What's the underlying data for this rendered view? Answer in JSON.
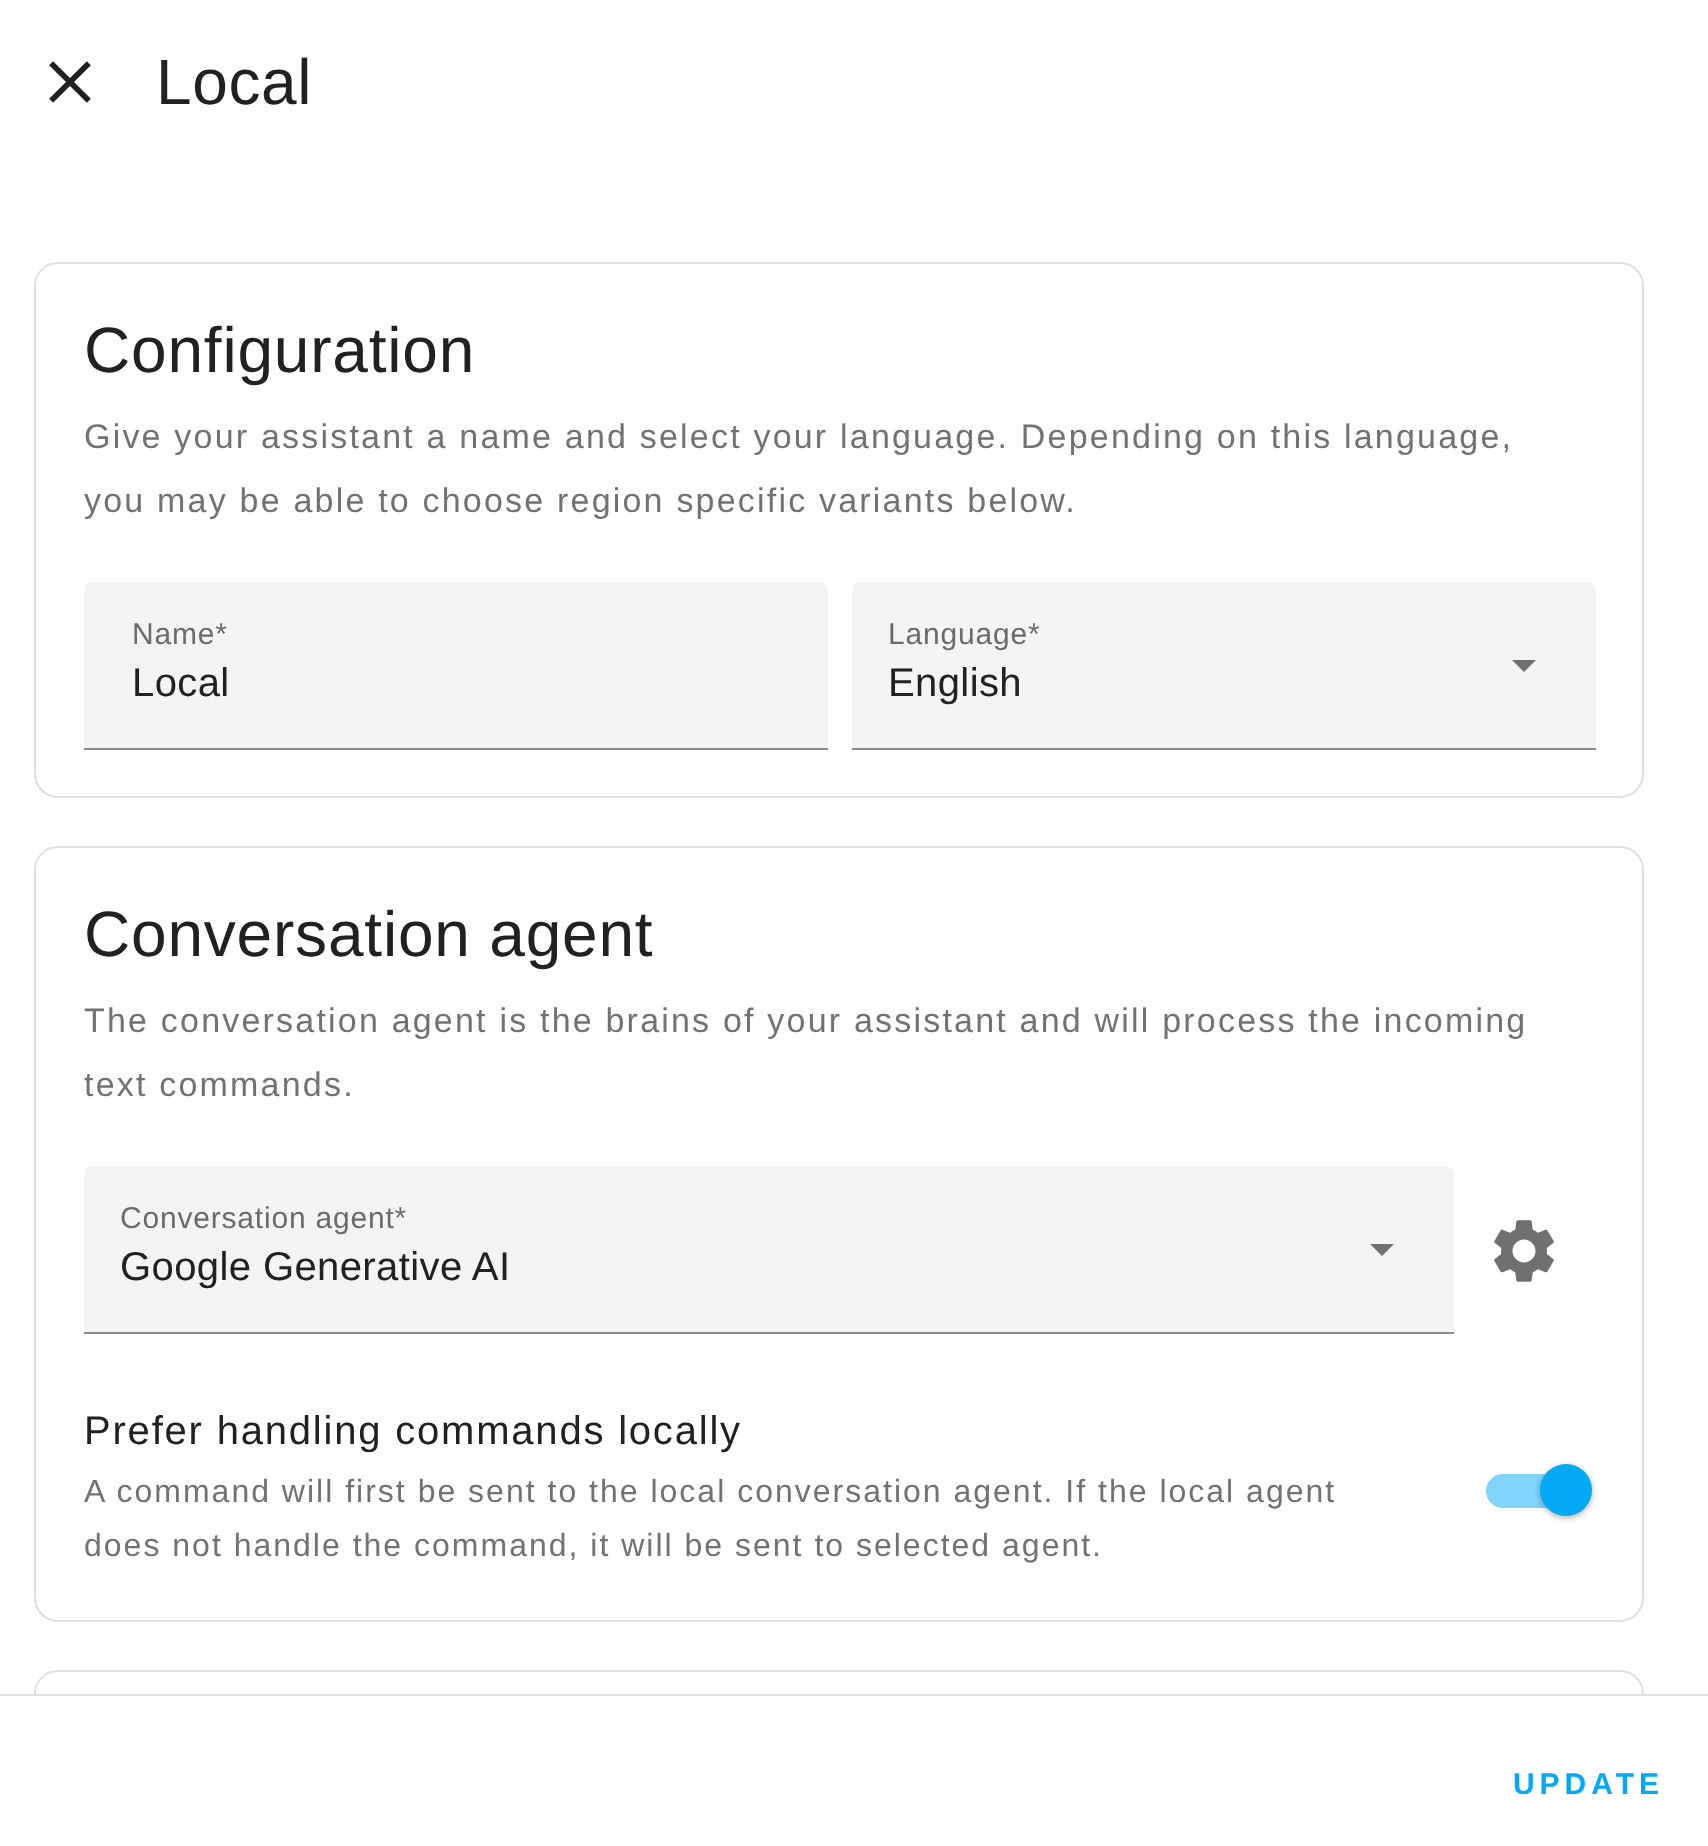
{
  "header": {
    "title": "Local"
  },
  "sections": [
    {
      "title": "Configuration",
      "description": "Give your assistant a name and select your language. Depending on this language, you may be able to choose region specific variants below.",
      "fields": [
        {
          "kind": "text",
          "label": "Name*",
          "value": "Local"
        },
        {
          "kind": "select",
          "label": "Language*",
          "value": "English"
        }
      ]
    },
    {
      "title": "Conversation agent",
      "description": "The conversation agent is the brains of your assistant and will process the incoming text commands.",
      "fields": [
        {
          "kind": "select",
          "label": "Conversation agent*",
          "value": "Google Generative AI",
          "has_settings": true
        }
      ],
      "toggle": {
        "label": "Prefer handling commands locally",
        "description": "A command will first be sent to the local conversation agent. If the local agent does not handle the command, it will be sent to selected agent.",
        "on": true
      }
    }
  ],
  "footer": {
    "button": "UPDATE"
  }
}
